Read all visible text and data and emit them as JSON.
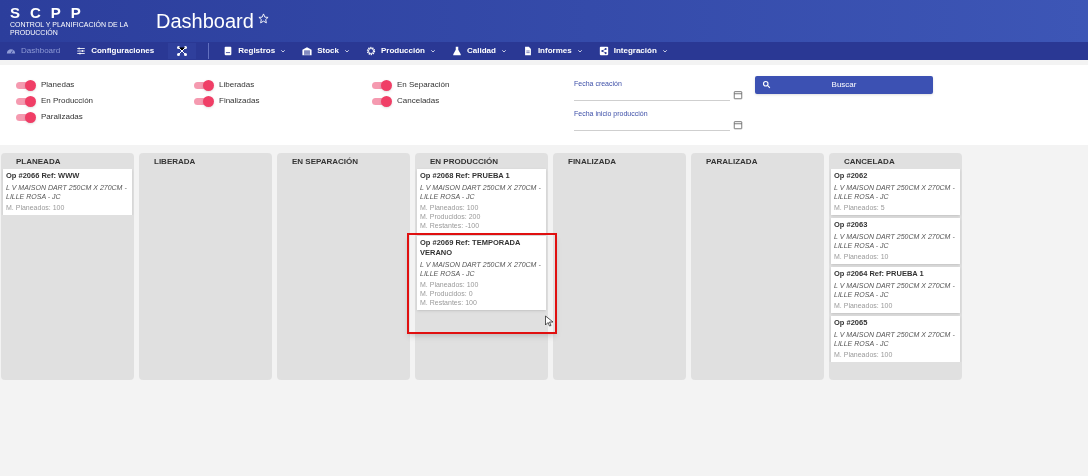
{
  "header": {
    "logo": "SCPP",
    "logo_subtitle": "CONTROL Y PLANIFICACIÓN DE LA PRODUCCIÓN",
    "title": "Dashboard",
    "favorite": false
  },
  "nav": [
    {
      "kind": "gauge",
      "label": "Dashboard",
      "selected": true,
      "menu": false
    },
    {
      "kind": "sliders",
      "label": "Configuraciones",
      "selected": false,
      "menu": false
    },
    {
      "kind": "hierarchy",
      "selected": false,
      "menu": false
    },
    {
      "kind": "book",
      "label": "Registros",
      "selected": false,
      "menu": true
    },
    {
      "kind": "warehouse",
      "label": "Stock",
      "selected": false,
      "menu": true
    },
    {
      "kind": "gear",
      "label": "Producción",
      "selected": false,
      "menu": true
    },
    {
      "kind": "flask",
      "label": "Calidad",
      "selected": false,
      "menu": true
    },
    {
      "kind": "document",
      "label": "Informes",
      "selected": false,
      "menu": true
    },
    {
      "kind": "share",
      "label": "Integración",
      "selected": false,
      "menu": true
    }
  ],
  "filter_columns": [
    {
      "toggles": [
        {
          "label": "Planedas",
          "on": true
        },
        {
          "label": "En Producción",
          "on": true
        },
        {
          "label": "Paralizadas",
          "on": true
        }
      ]
    },
    {
      "toggles": [
        {
          "label": "Liberadas",
          "on": true
        },
        {
          "label": "Finalizadas",
          "on": true
        }
      ]
    },
    {
      "toggles": [
        {
          "label": "En Separación",
          "on": true
        },
        {
          "label": "Canceladas",
          "on": true
        }
      ]
    }
  ],
  "date_fields": [
    {
      "label": "Fecha creación"
    },
    {
      "label": "Fecha inicio producción"
    }
  ],
  "search_button": "Buscar",
  "columns": [
    {
      "title": "PLANEADA",
      "cards": [
        {
          "title": "Op #2066 Ref: WWW",
          "description": "L V MAISON DART 250CM X 270CM - LILLE ROSA - JC",
          "stats": [
            "M. Planeados: 100"
          ],
          "highlighted": false
        }
      ]
    },
    {
      "title": "LIBERADA"
    },
    {
      "title": "EN SEPARACIÓN"
    },
    {
      "title": "EN PRODUCCIÓN",
      "cards": [
        {
          "title": "Op #2068 Ref: PRUEBA 1",
          "description": "L V MAISON DART 250CM X 270CM - LILLE ROSA - JC",
          "stats": [
            "M. Planeados: 100",
            "M. Producidos: 200",
            "M. Restantes: -100"
          ],
          "highlighted": false
        },
        {
          "title": "Op #2069 Ref: TEMPORADA VERANO",
          "description": "L V MAISON DART 250CM X 270CM - LILLE ROSA - JC",
          "stats": [
            "M. Planeados: 100",
            "M. Producidos: 0",
            "M. Restantes: 100"
          ],
          "highlighted": true
        }
      ]
    },
    {
      "title": "FINALIZADA"
    },
    {
      "title": "PARALIZADA"
    },
    {
      "title": "CANCELADA",
      "cards": [
        {
          "title": "Op #2062",
          "description": "L V MAISON DART 250CM X 270CM - LILLE ROSA - JC",
          "stats": [
            "M. Planeados: 5"
          ],
          "highlighted": false
        },
        {
          "title": "Op #2063",
          "description": "L V MAISON DART 250CM X 270CM - LILLE ROSA - JC",
          "stats": [
            "M. Planeados: 10"
          ],
          "highlighted": false
        },
        {
          "title": "Op #2064 Ref: PRUEBA 1",
          "description": "L V MAISON DART 250CM X 270CM - LILLE ROSA - JC",
          "stats": [
            "M. Planeados: 100"
          ],
          "highlighted": false
        },
        {
          "title": "Op #2065",
          "description": "L V MAISON DART 250CM X 270CM - LILLE ROSA - JC",
          "stats": [
            "M. Planeados: 100"
          ],
          "highlighted": false
        }
      ]
    }
  ]
}
